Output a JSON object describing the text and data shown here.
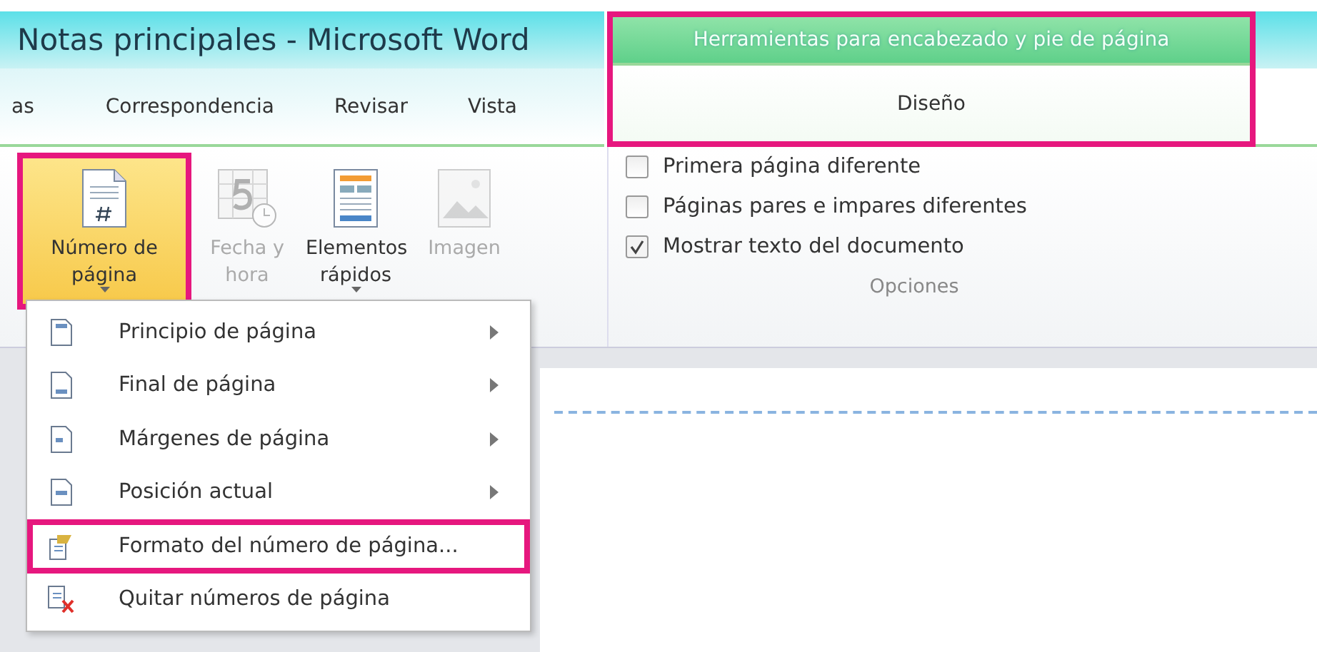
{
  "window": {
    "title": "Notas principales - Microsoft Word"
  },
  "contextual_tab_group": {
    "title": "Herramientas para encabezado y pie de página",
    "highlighted": true
  },
  "tabs": [
    {
      "label": "as",
      "selected": false
    },
    {
      "label": "Correspondencia",
      "selected": false
    },
    {
      "label": "Revisar",
      "selected": false
    },
    {
      "label": "Vista",
      "selected": false
    }
  ],
  "contextual_tabs": [
    {
      "label": "Diseño",
      "selected": true
    }
  ],
  "ribbon_buttons": [
    {
      "kind": "page-number",
      "label": "Número de página",
      "dropdown": true,
      "active": true,
      "disabled": false,
      "highlighted": true
    },
    {
      "kind": "date",
      "label": "Fecha y hora",
      "dropdown": false,
      "active": false,
      "disabled": true,
      "highlighted": false
    },
    {
      "kind": "quick-parts",
      "label": "Elementos rápidos",
      "dropdown": true,
      "active": false,
      "disabled": false,
      "highlighted": false
    },
    {
      "kind": "picture",
      "label": "Imagen",
      "dropdown": false,
      "active": false,
      "disabled": true,
      "highlighted": false
    }
  ],
  "options_group": {
    "label": "Opciones",
    "checkboxes": [
      {
        "label": "Primera página diferente",
        "checked": false
      },
      {
        "label": "Páginas pares e impares diferentes",
        "checked": false
      },
      {
        "label": "Mostrar texto del documento",
        "checked": true
      }
    ]
  },
  "menu": [
    {
      "kind": "top",
      "label": "Principio de página",
      "submenu": true,
      "highlighted": false
    },
    {
      "kind": "bottom",
      "label": "Final de página",
      "submenu": true,
      "highlighted": false
    },
    {
      "kind": "margins",
      "label": "Márgenes de página",
      "submenu": true,
      "highlighted": false
    },
    {
      "kind": "current",
      "label": "Posición actual",
      "submenu": true,
      "highlighted": false
    },
    {
      "kind": "format",
      "label": "Formato del número de página...",
      "submenu": false,
      "highlighted": true
    },
    {
      "kind": "remove",
      "label": "Quitar números de página",
      "submenu": false,
      "highlighted": false
    }
  ]
}
